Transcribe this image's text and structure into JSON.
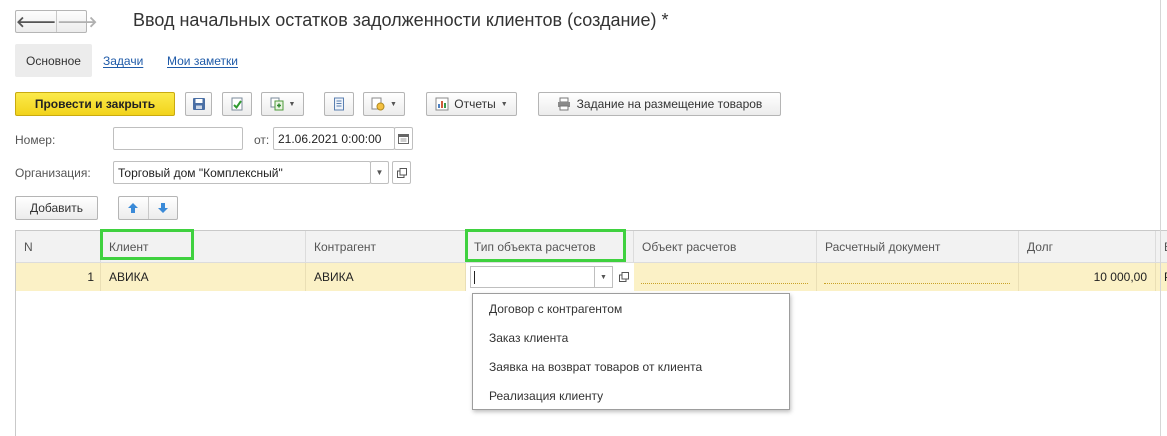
{
  "window": {
    "title": "Ввод начальных остатков задолженности клиентов (создание) *"
  },
  "nav": {
    "back": "🡐",
    "forward": "🡒"
  },
  "tabs": [
    {
      "label": "Основное",
      "active": true
    },
    {
      "label": "Задачи",
      "active": false
    },
    {
      "label": "Мои заметки",
      "active": false
    }
  ],
  "toolbar": {
    "post_close": "Провести и закрыть",
    "reports": "Отчеты",
    "placement_task": "Задание на размещение товаров"
  },
  "form": {
    "number_label": "Номер:",
    "number_value": "",
    "date_label": "от:",
    "date_value": "21.06.2021  0:00:00",
    "org_label": "Организация:",
    "org_value": "Торговый дом \"Комплексный\""
  },
  "table_toolbar": {
    "add": "Добавить"
  },
  "table": {
    "columns": [
      "N",
      "Клиент",
      "Контрагент",
      "Тип объекта расчетов",
      "Объект расчетов",
      "Расчетный документ",
      "Долг",
      "В"
    ],
    "rows": [
      {
        "n": "1",
        "client": "АВИКА",
        "contractor": "АВИКА",
        "object_type": "",
        "object": "",
        "document": "",
        "debt": "10 000,00",
        "extra": "Р"
      }
    ]
  },
  "dropdown": {
    "options": [
      "Договор с контрагентом",
      "Заказ клиента",
      "Заявка на возврат товаров от клиента",
      "Реализация клиенту"
    ]
  },
  "colors": {
    "accent_yellow": "#f2d31b",
    "row_highlight": "#fbf1c6",
    "annotation_green": "#3fd13f",
    "link": "#1e5aa8"
  }
}
